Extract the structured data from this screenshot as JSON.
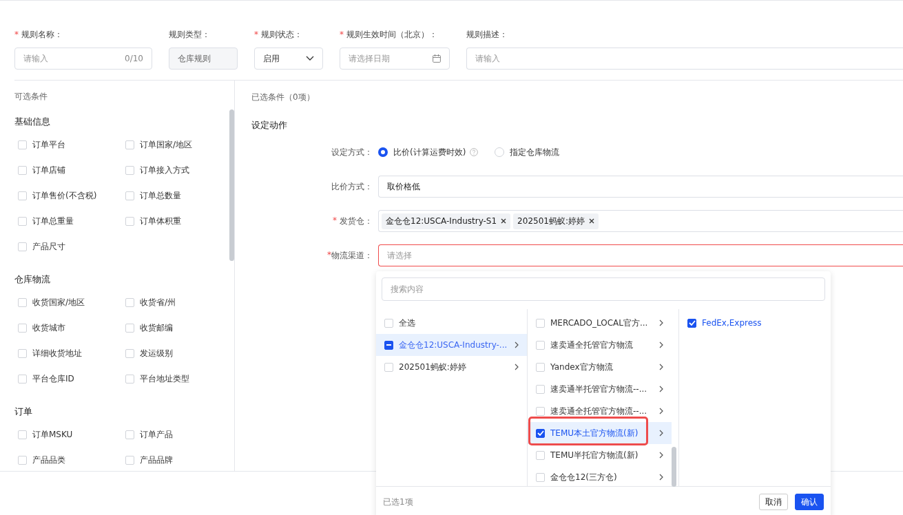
{
  "header_fields": [
    {
      "label": "规则名称：",
      "required_mark": "*",
      "kind": "text",
      "placeholder": "请输入",
      "counter": "0/10"
    },
    {
      "label": "规则类型：",
      "kind": "readonly",
      "value": "仓库规则"
    },
    {
      "label": "规则状态：",
      "required_mark": "*",
      "kind": "select",
      "value": "启用"
    },
    {
      "label": "规则生效时间（北京）：",
      "required_mark": "*",
      "kind": "date",
      "placeholder": "请选择日期"
    },
    {
      "label": "规则描述：",
      "kind": "wide",
      "placeholder": "请输入"
    }
  ],
  "available_conditions": {
    "title": "可选条件",
    "groups": [
      {
        "title": "基础信息",
        "items": [
          {
            "label": "订单平台",
            "checked": false
          },
          {
            "label": "订单国家/地区",
            "checked": false
          },
          {
            "label": "订单店铺",
            "checked": false
          },
          {
            "label": "订单接入方式",
            "checked": false
          },
          {
            "label": "订单售价(不含税)",
            "checked": false
          },
          {
            "label": "订单总数量",
            "checked": false
          },
          {
            "label": "订单总重量",
            "checked": false
          },
          {
            "label": "订单体积重",
            "checked": false
          },
          {
            "label": "产品尺寸",
            "checked": false
          }
        ]
      },
      {
        "title": "仓库物流",
        "items": [
          {
            "label": "收货国家/地区",
            "checked": false
          },
          {
            "label": "收货省/州",
            "checked": false
          },
          {
            "label": "收货城市",
            "checked": false
          },
          {
            "label": "收货邮编",
            "checked": false
          },
          {
            "label": "详细收货地址",
            "checked": false
          },
          {
            "label": "发运级别",
            "checked": false
          },
          {
            "label": "平台仓库ID",
            "checked": false
          },
          {
            "label": "平台地址类型",
            "checked": false
          }
        ]
      },
      {
        "title": "订单",
        "items": [
          {
            "label": "订单MSKU",
            "checked": false
          },
          {
            "label": "订单产品",
            "checked": false
          },
          {
            "label": "产品品类",
            "checked": false
          },
          {
            "label": "产品品牌",
            "checked": false
          }
        ]
      }
    ]
  },
  "selected_conditions": {
    "title": "已选条件（0项）"
  },
  "action": {
    "title": "设定动作",
    "method": {
      "label": "设定方式：",
      "options": [
        {
          "label": "比价(计算运费时效)",
          "selected": true,
          "help": true
        },
        {
          "label": "指定仓库物流",
          "selected": false,
          "help": false
        }
      ]
    },
    "compare": {
      "label": "比价方式：",
      "value": "取价格低"
    },
    "warehouse": {
      "label": "发货仓：",
      "required_mark": "*",
      "tags": [
        "金仓仓12:USCA-Industry-S1",
        "202501蚂蚁:婷婷"
      ]
    },
    "channel": {
      "label": "物流渠道：",
      "required_mark": "*",
      "placeholder": "请选择",
      "error": true
    }
  },
  "cascader": {
    "search_placeholder": "搜索内容",
    "columns": [
      [
        {
          "label": "全选",
          "checked": false,
          "indeterminate": false,
          "active": false,
          "expandable": false,
          "annotated": false
        },
        {
          "label": "金仓仓12:USCA-Industry-...",
          "checked": false,
          "indeterminate": true,
          "active": true,
          "expandable": true,
          "annotated": false
        },
        {
          "label": "202501蚂蚁:婷婷",
          "checked": false,
          "indeterminate": false,
          "active": false,
          "expandable": true,
          "annotated": false
        }
      ],
      [
        {
          "label": "MERCADO_LOCAL官方...",
          "checked": false,
          "indeterminate": false,
          "active": false,
          "expandable": true,
          "annotated": false
        },
        {
          "label": "速卖通全托管官方物流",
          "checked": false,
          "indeterminate": false,
          "active": false,
          "expandable": true,
          "annotated": false
        },
        {
          "label": "Yandex官方物流",
          "checked": false,
          "indeterminate": false,
          "active": false,
          "expandable": true,
          "annotated": false
        },
        {
          "label": "速卖通半托管官方物流--...",
          "checked": false,
          "indeterminate": false,
          "active": false,
          "expandable": true,
          "annotated": false
        },
        {
          "label": "速卖通全托管官方物流--...",
          "checked": false,
          "indeterminate": false,
          "active": false,
          "expandable": true,
          "annotated": false
        },
        {
          "label": "TEMU本土官方物流(新)",
          "checked": true,
          "indeterminate": false,
          "active": true,
          "expandable": true,
          "annotated": true
        },
        {
          "label": "TEMU半托官方物流(新)",
          "checked": false,
          "indeterminate": false,
          "active": false,
          "expandable": true,
          "annotated": false
        },
        {
          "label": "金仓仓12(三方仓)",
          "checked": false,
          "indeterminate": false,
          "active": false,
          "expandable": true,
          "annotated": false
        }
      ],
      [
        {
          "label": "FedEx,Express",
          "checked": true,
          "indeterminate": false,
          "active": false,
          "expandable": false,
          "annotated": false
        }
      ]
    ],
    "selected_count": "已选1项",
    "buttons": [
      {
        "label": "取消",
        "primary": false
      },
      {
        "label": "确认",
        "primary": true
      }
    ]
  }
}
